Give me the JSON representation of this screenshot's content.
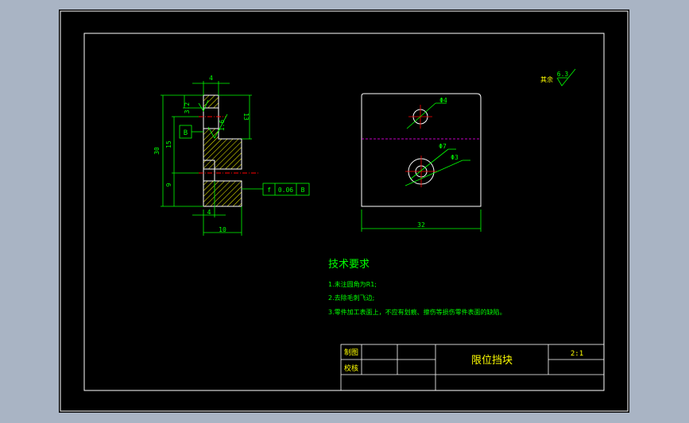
{
  "colors": {
    "background": "#a9b4c4",
    "paper": "#000000",
    "frame": "#ffffff",
    "dim": "#00ff00",
    "center": "#ff0000",
    "hatch": "#ffff00",
    "hidden": "#ff00ff",
    "text_green": "#00ff00",
    "text_yellow": "#ffff00"
  },
  "side_view": {
    "dims": {
      "top_width": "4",
      "dim_32": "3.2",
      "dim_16": "1.6",
      "dim_13": "13",
      "dim_30": "30",
      "dim_15": "15",
      "dim_9": "9",
      "bottom_4": "4",
      "bottom_10": "10"
    },
    "datum": "B",
    "tolerance": {
      "symbol": "f",
      "value": "0.06",
      "datum": "B"
    }
  },
  "front_view": {
    "dims": {
      "hole_top": "Φ4",
      "hole_small": "Φ7",
      "hole_large": "Φ3",
      "width": "32"
    }
  },
  "surface_finish": {
    "label": "其余",
    "value": "6.3"
  },
  "tech_requirements": {
    "title": "技术要求",
    "items": [
      "1.未注圆角为R1;",
      "2.去除毛刺飞边;",
      "3.零件加工表面上，不应有划痕、擦伤等损伤零件表面的缺陷。"
    ]
  },
  "title_block": {
    "drawn_label": "制图",
    "checked_label": "校核",
    "part_name": "限位挡块",
    "scale": "2:1"
  }
}
